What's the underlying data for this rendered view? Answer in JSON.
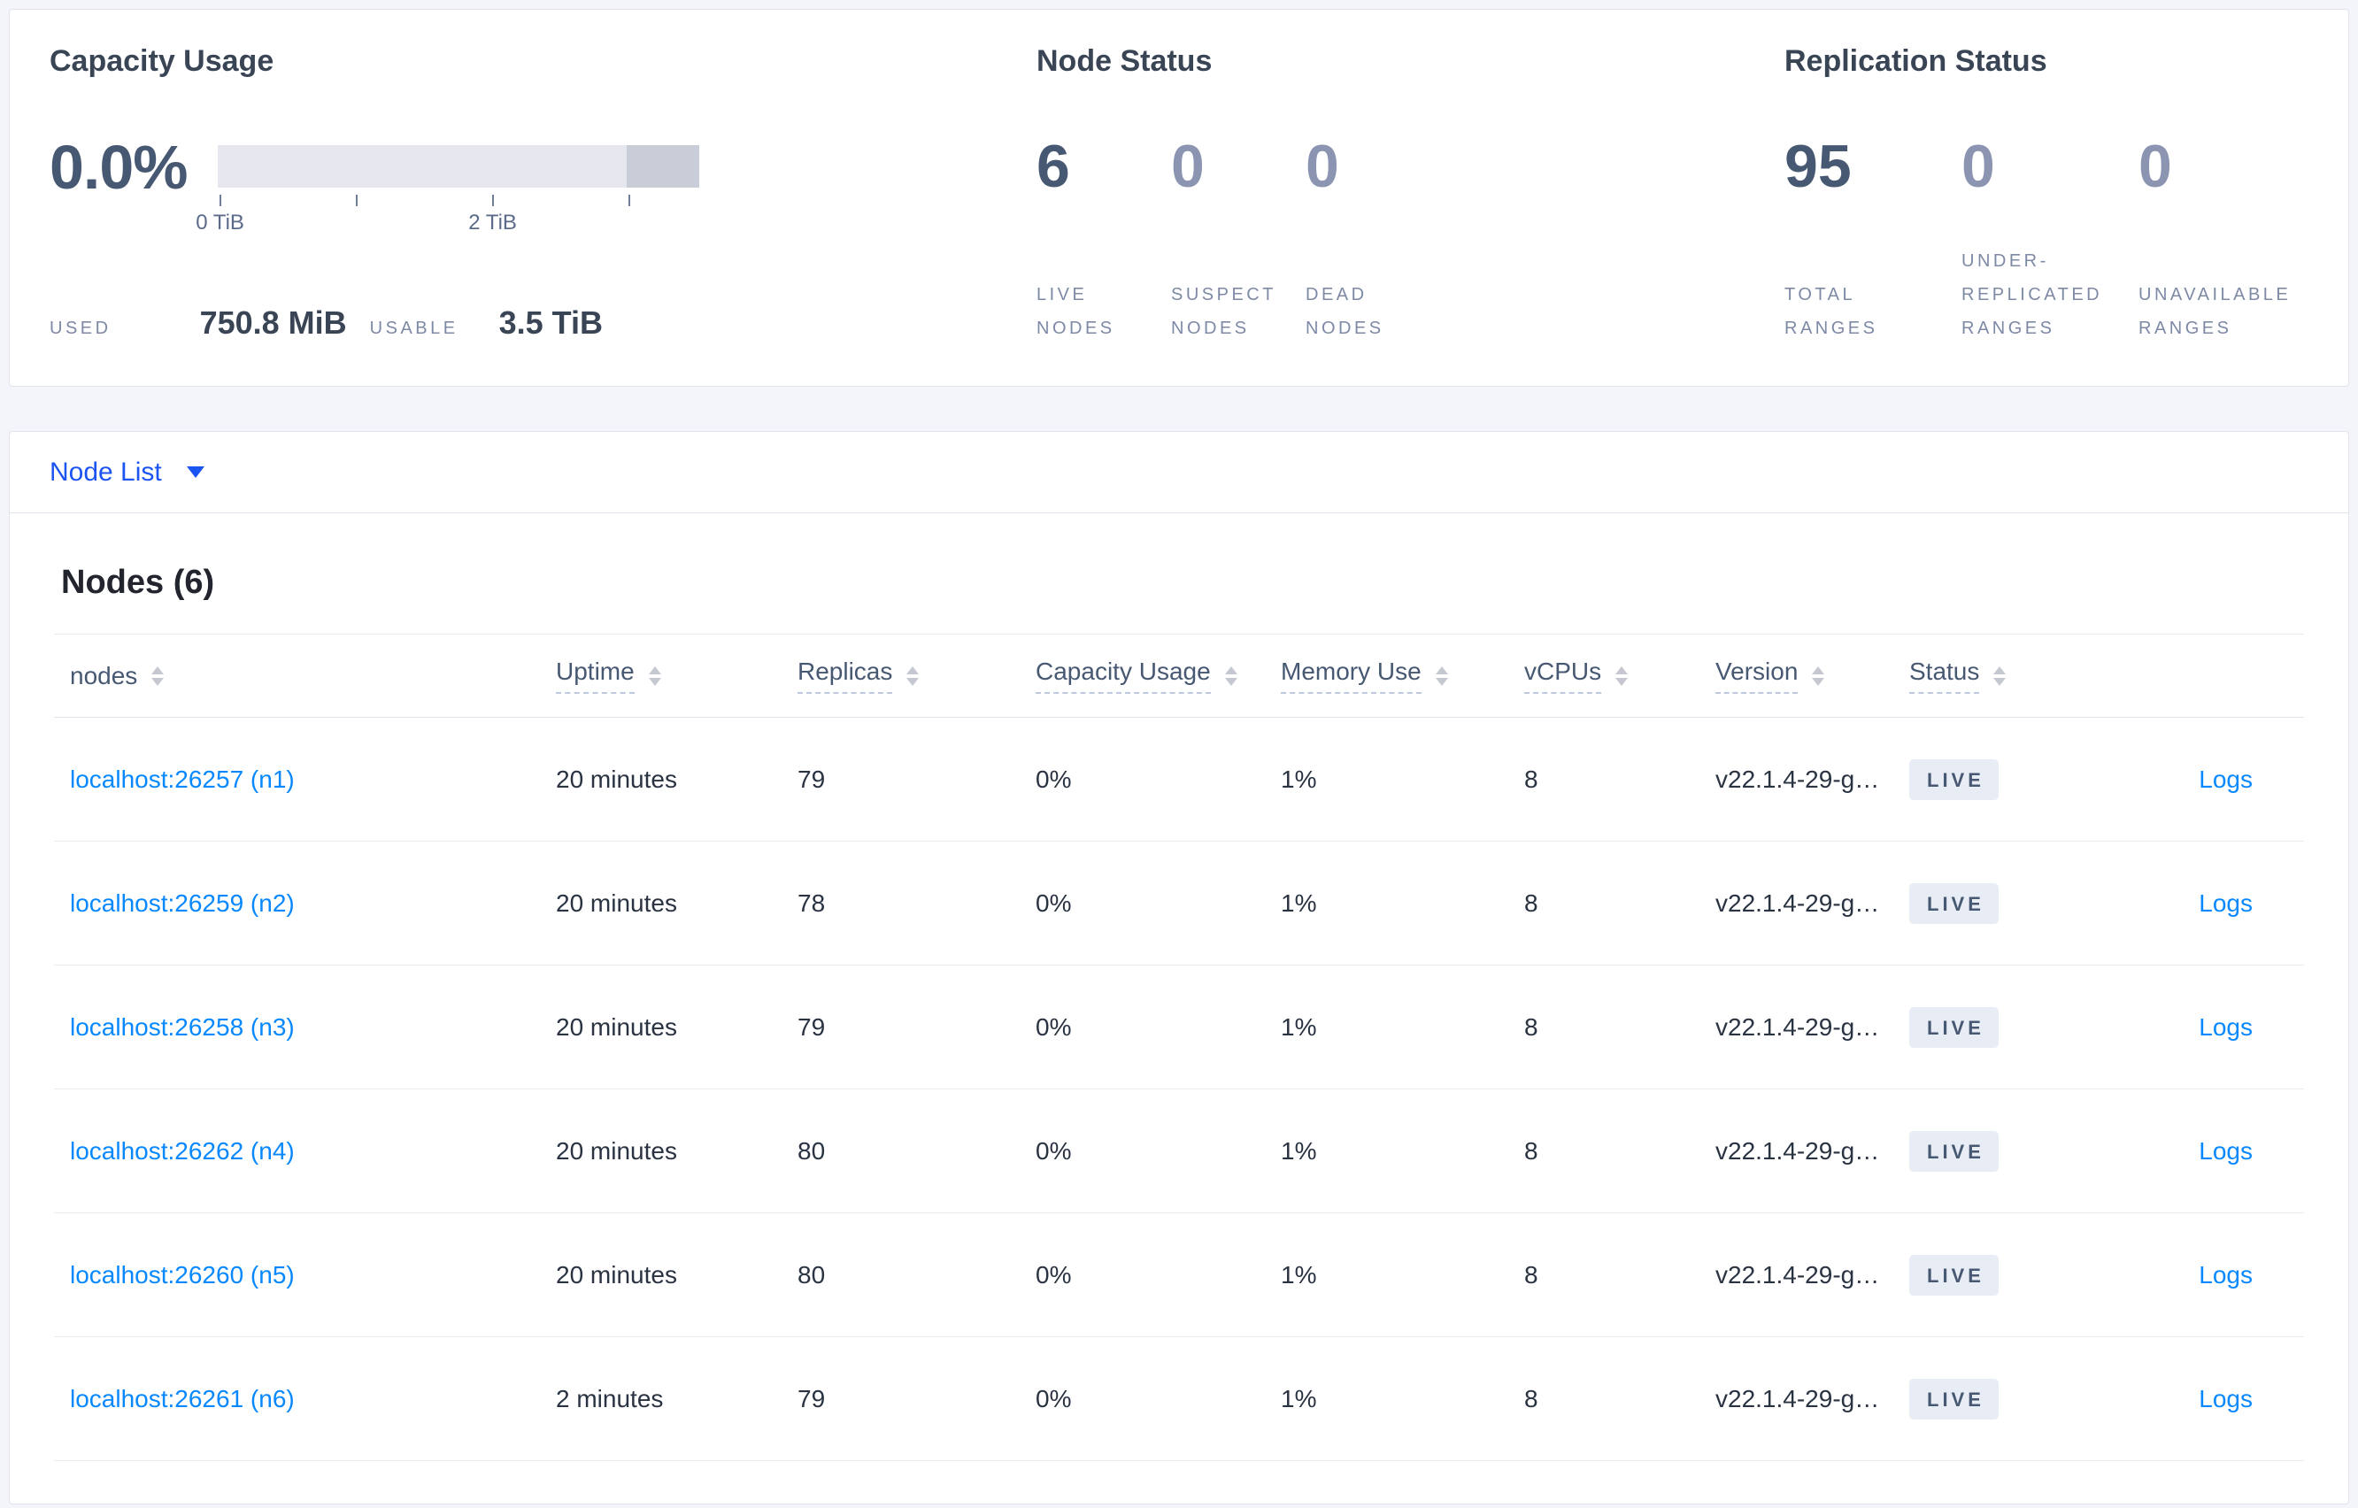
{
  "summary": {
    "capacity": {
      "title": "Capacity Usage",
      "percent": "0.0%",
      "tick_labels": [
        "0 TiB",
        "2 TiB"
      ],
      "used_label": "USED",
      "used_value": "750.8 MiB",
      "usable_label": "USABLE",
      "usable_value": "3.5 TiB"
    },
    "node_status": {
      "title": "Node Status",
      "stats": [
        {
          "value": "6",
          "label": "LIVE NODES",
          "tone": "dark"
        },
        {
          "value": "0",
          "label": "SUSPECT NODES",
          "tone": "light"
        },
        {
          "value": "0",
          "label": "DEAD NODES",
          "tone": "light"
        }
      ]
    },
    "replication": {
      "title": "Replication Status",
      "stats": [
        {
          "value": "95",
          "label": "TOTAL RANGES",
          "tone": "dark"
        },
        {
          "value": "0",
          "label": "UNDER-REPLICATED RANGES",
          "tone": "light"
        },
        {
          "value": "0",
          "label": "UNAVAILABLE RANGES",
          "tone": "light"
        }
      ]
    }
  },
  "node_list": {
    "label": "Node List"
  },
  "nodes_table": {
    "heading": "Nodes (6)",
    "columns": [
      {
        "label": "nodes",
        "sortable": true,
        "underline": false
      },
      {
        "label": "Uptime",
        "sortable": true,
        "underline": true
      },
      {
        "label": "Replicas",
        "sortable": true,
        "underline": true
      },
      {
        "label": "Capacity Usage",
        "sortable": true,
        "underline": true
      },
      {
        "label": "Memory Use",
        "sortable": true,
        "underline": true
      },
      {
        "label": "vCPUs",
        "sortable": true,
        "underline": true
      },
      {
        "label": "Version",
        "sortable": true,
        "underline": true
      },
      {
        "label": "Status",
        "sortable": true,
        "underline": true
      },
      {
        "label": "",
        "sortable": false,
        "underline": false
      }
    ],
    "rows": [
      {
        "address": "localhost:26257 (n1)",
        "uptime": "20 minutes",
        "replicas": "79",
        "capacity": "0%",
        "memory": "1%",
        "vcpus": "8",
        "version": "v22.1.4-29-g…",
        "status": "LIVE",
        "logs": "Logs"
      },
      {
        "address": "localhost:26259 (n2)",
        "uptime": "20 minutes",
        "replicas": "78",
        "capacity": "0%",
        "memory": "1%",
        "vcpus": "8",
        "version": "v22.1.4-29-g…",
        "status": "LIVE",
        "logs": "Logs"
      },
      {
        "address": "localhost:26258 (n3)",
        "uptime": "20 minutes",
        "replicas": "79",
        "capacity": "0%",
        "memory": "1%",
        "vcpus": "8",
        "version": "v22.1.4-29-g…",
        "status": "LIVE",
        "logs": "Logs"
      },
      {
        "address": "localhost:26262 (n4)",
        "uptime": "20 minutes",
        "replicas": "80",
        "capacity": "0%",
        "memory": "1%",
        "vcpus": "8",
        "version": "v22.1.4-29-g…",
        "status": "LIVE",
        "logs": "Logs"
      },
      {
        "address": "localhost:26260 (n5)",
        "uptime": "20 minutes",
        "replicas": "80",
        "capacity": "0%",
        "memory": "1%",
        "vcpus": "8",
        "version": "v22.1.4-29-g…",
        "status": "LIVE",
        "logs": "Logs"
      },
      {
        "address": "localhost:26261 (n6)",
        "uptime": "2 minutes",
        "replicas": "79",
        "capacity": "0%",
        "memory": "1%",
        "vcpus": "8",
        "version": "v22.1.4-29-g…",
        "status": "LIVE",
        "logs": "Logs"
      }
    ]
  },
  "chart_data": {
    "type": "bar",
    "title": "Capacity Usage",
    "percent_used": "0.0%",
    "used": "750.8 MiB",
    "usable": "3.5 TiB",
    "x_tick_labels": [
      "0 TiB",
      "2 TiB"
    ],
    "bar_segments": [
      {
        "name": "usable",
        "fraction": 0.85,
        "color": "#e6e7ee"
      },
      {
        "name": "other",
        "fraction": 0.15,
        "color": "#c9cdd8"
      }
    ]
  },
  "colors": {
    "link_blue": "#0788ff",
    "dropdown_blue": "#1c54f2",
    "badge_bg": "#e8ecf4",
    "slate_dark": "#475872",
    "slate_light": "#8b95b2",
    "page_bg": "#f4f5fa"
  }
}
